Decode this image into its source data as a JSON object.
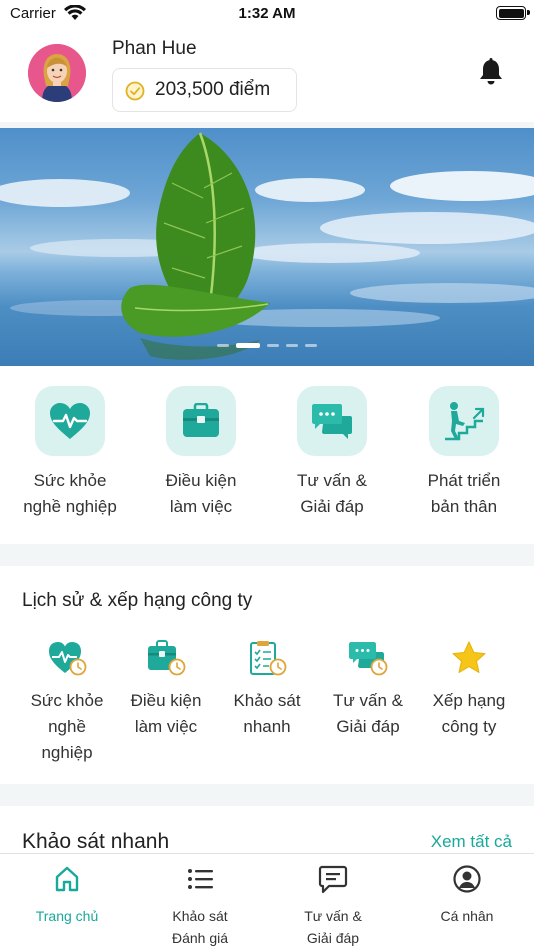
{
  "status_bar": {
    "carrier": "Carrier",
    "time": "1:32 AM"
  },
  "header": {
    "user_name": "Phan Hue",
    "points": "203,500 điểm"
  },
  "banner": {
    "slide_count": 5,
    "active_slide": 1
  },
  "categories": [
    {
      "label": "Sức khỏe\nnghề nghiệp",
      "icon": "heart-pulse-icon"
    },
    {
      "label": "Điều kiện\nlàm việc",
      "icon": "briefcase-icon"
    },
    {
      "label": "Tư vấn &\nGiải đáp",
      "icon": "chat-bubbles-icon"
    },
    {
      "label": "Phát triển\nbản thân",
      "icon": "stairs-climb-icon"
    }
  ],
  "history": {
    "title": "Lịch sử & xếp hạng công ty",
    "items": [
      {
        "label": "Sức khỏe\nnghề\nnghiệp",
        "icon": "heart-clock-icon"
      },
      {
        "label": "Điều kiện\nlàm việc",
        "icon": "briefcase-clock-icon"
      },
      {
        "label": "Khảo sát\nnhanh",
        "icon": "clipboard-clock-icon"
      },
      {
        "label": "Tư vấn &\nGiải đáp",
        "icon": "chat-clock-icon"
      },
      {
        "label": "Xếp hạng\ncông ty",
        "icon": "star-icon"
      }
    ]
  },
  "quick_survey": {
    "title": "Khảo sát nhanh",
    "see_all": "Xem tất cả"
  },
  "tabbar": [
    {
      "label": "Trang chủ",
      "icon": "home-icon",
      "active": true
    },
    {
      "label": "Khảo sát\nĐánh giá",
      "icon": "list-icon",
      "active": false
    },
    {
      "label": "Tư vấn &\nGiải đáp",
      "icon": "message-icon",
      "active": false
    },
    {
      "label": "Cá nhân",
      "icon": "user-circle-icon",
      "active": false
    }
  ],
  "colors": {
    "accent": "#19a89a",
    "icon_bg": "#d9f2ef",
    "avatar_bg": "#e8578b"
  }
}
